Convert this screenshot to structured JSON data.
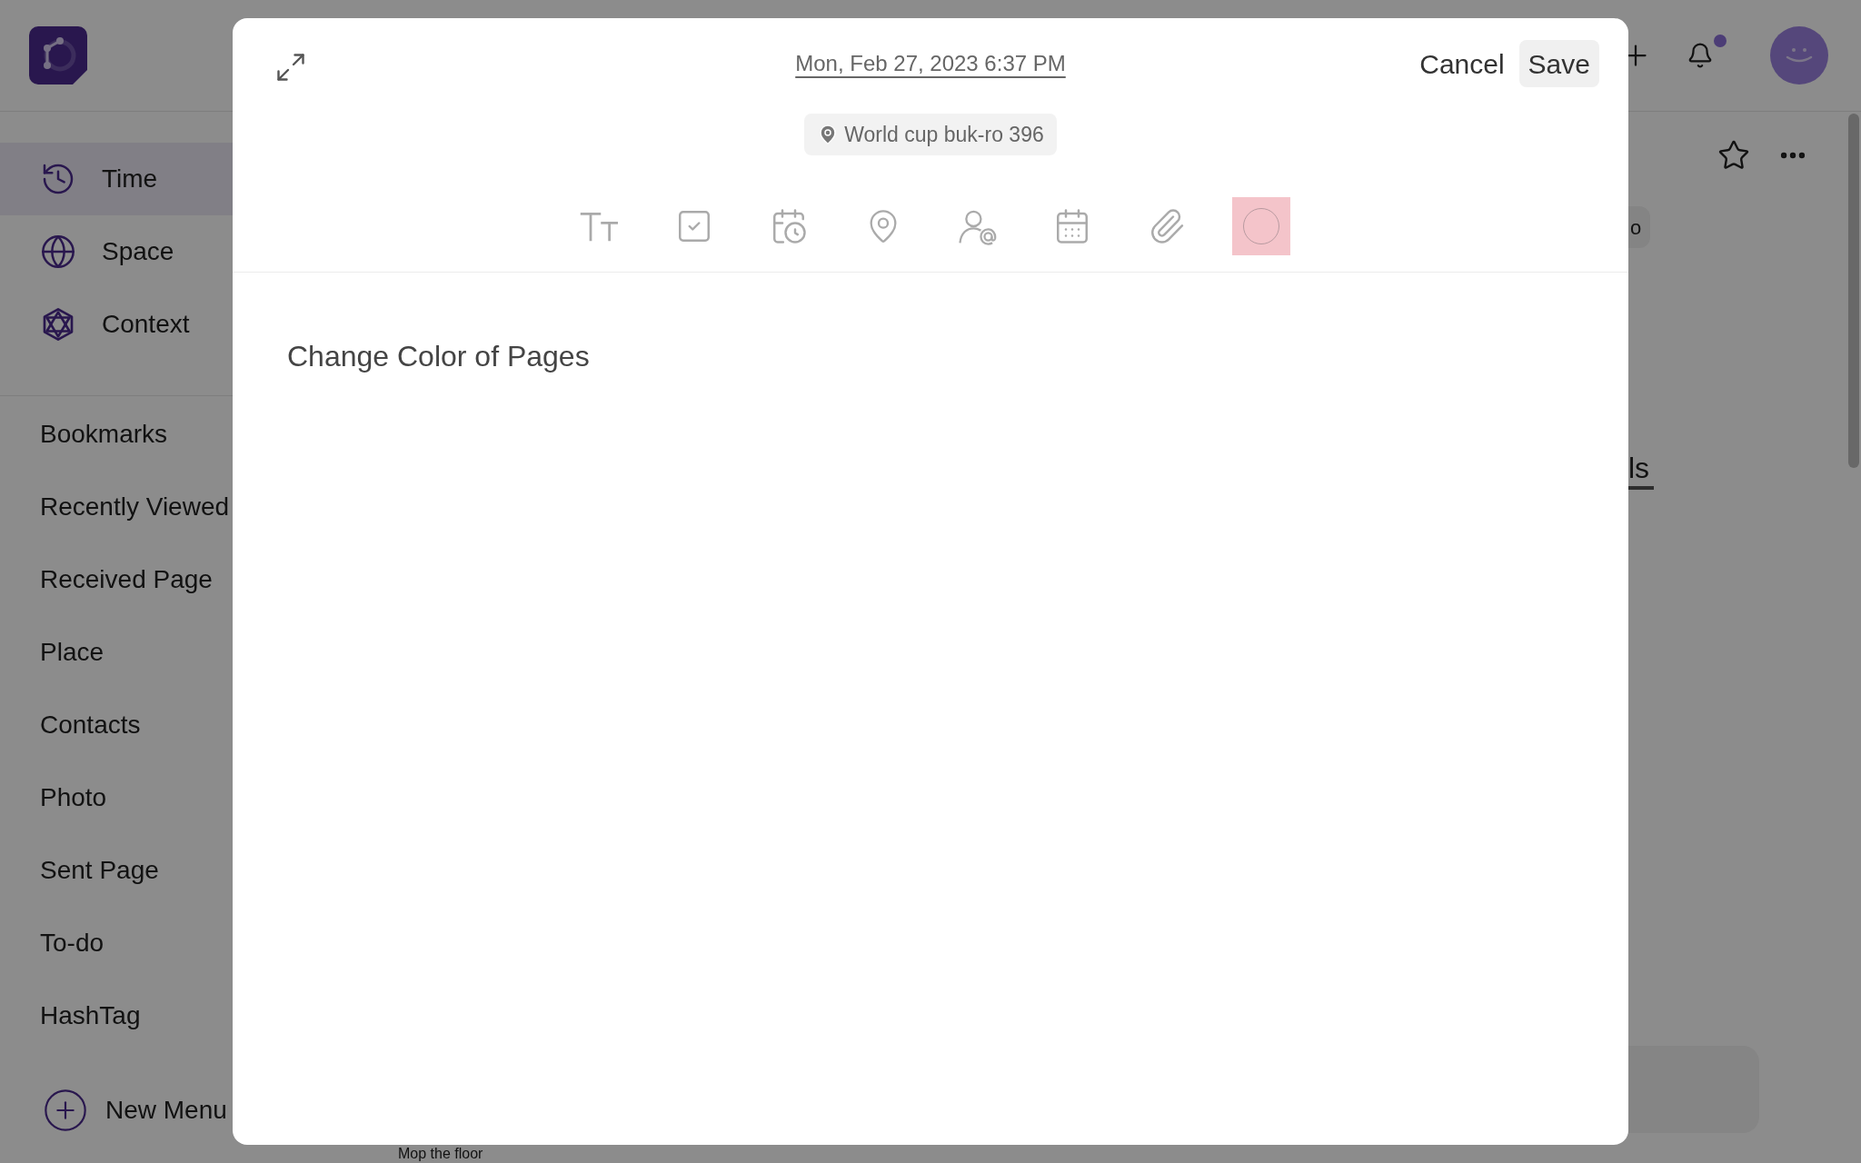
{
  "sidebar": {
    "primary_items": [
      {
        "label": "Time",
        "selected": true
      },
      {
        "label": "Space",
        "selected": false
      },
      {
        "label": "Context",
        "selected": false
      }
    ],
    "menu_items": [
      "Bookmarks",
      "Recently Viewed",
      "Received Page",
      "Place",
      "Contacts",
      "Photo",
      "Sent Page",
      "To-do",
      "HashTag"
    ],
    "new_menu": "New Menu"
  },
  "header": {
    "unread_notifications": true
  },
  "background": {
    "chip_fragment": "o",
    "heading_fragment": "ls",
    "todo_item": "Mop the floor"
  },
  "modal": {
    "date": "Mon, Feb 27, 2023 6:37 PM",
    "location": "World cup buk-ro 396",
    "cancel": "Cancel",
    "save": "Save",
    "tools": [
      {
        "kind": "text",
        "selected": false
      },
      {
        "kind": "todo",
        "selected": false
      },
      {
        "kind": "schedule",
        "selected": false
      },
      {
        "kind": "place",
        "selected": false
      },
      {
        "kind": "mention",
        "selected": false
      },
      {
        "kind": "calendar",
        "selected": false
      },
      {
        "kind": "attachment",
        "selected": false
      },
      {
        "kind": "color",
        "selected": true
      }
    ],
    "content": "Change Color of Pages"
  }
}
